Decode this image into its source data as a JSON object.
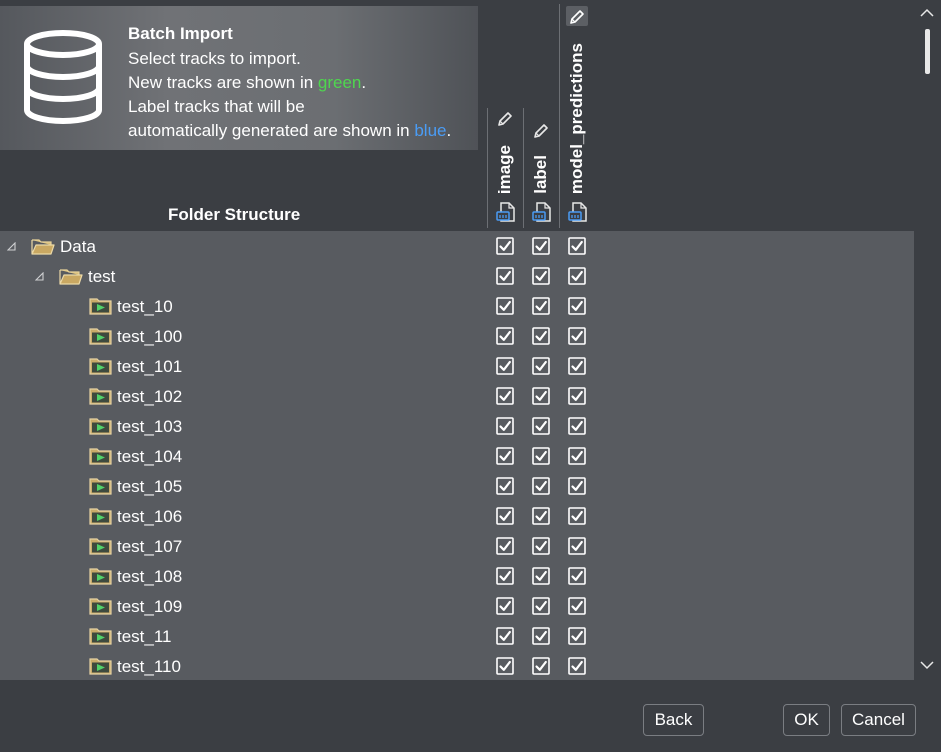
{
  "banner": {
    "title": "Batch Import",
    "line1": "Select tracks to import.",
    "line2_pre": "New tracks are shown in ",
    "line2_green": "green",
    "line2_post": ".",
    "line3": "Label tracks that will be",
    "line4_pre": "automatically generated are shown in ",
    "line4_blue": "blue",
    "line4_post": ".",
    "icon": "database-icon"
  },
  "tree_header": "Folder Structure",
  "columns": [
    {
      "title": "image",
      "icon_top": "pencil-icon",
      "icon_bottom": "document-icon"
    },
    {
      "title": "label",
      "icon_top": "pencil-icon",
      "icon_bottom": "document-icon"
    },
    {
      "title": "model_predictions",
      "icon_top": "pencil-icon",
      "icon_bottom": "document-icon"
    }
  ],
  "tree": [
    {
      "label": "Data",
      "kind": "folder-open",
      "expanded": true,
      "checks": [
        true,
        true,
        true
      ]
    },
    {
      "label": "test",
      "kind": "folder-open",
      "expanded": true,
      "checks": [
        true,
        true,
        true
      ]
    },
    {
      "label": "test_10",
      "kind": "video-folder",
      "checks": [
        true,
        true,
        true
      ]
    },
    {
      "label": "test_100",
      "kind": "video-folder",
      "checks": [
        true,
        true,
        true
      ]
    },
    {
      "label": "test_101",
      "kind": "video-folder",
      "checks": [
        true,
        true,
        true
      ]
    },
    {
      "label": "test_102",
      "kind": "video-folder",
      "checks": [
        true,
        true,
        true
      ]
    },
    {
      "label": "test_103",
      "kind": "video-folder",
      "checks": [
        true,
        true,
        true
      ]
    },
    {
      "label": "test_104",
      "kind": "video-folder",
      "checks": [
        true,
        true,
        true
      ]
    },
    {
      "label": "test_105",
      "kind": "video-folder",
      "checks": [
        true,
        true,
        true
      ]
    },
    {
      "label": "test_106",
      "kind": "video-folder",
      "checks": [
        true,
        true,
        true
      ]
    },
    {
      "label": "test_107",
      "kind": "video-folder",
      "checks": [
        true,
        true,
        true
      ]
    },
    {
      "label": "test_108",
      "kind": "video-folder",
      "checks": [
        true,
        true,
        true
      ]
    },
    {
      "label": "test_109",
      "kind": "video-folder",
      "checks": [
        true,
        true,
        true
      ]
    },
    {
      "label": "test_11",
      "kind": "video-folder",
      "checks": [
        true,
        true,
        true
      ]
    },
    {
      "label": "test_110",
      "kind": "video-folder",
      "checks": [
        true,
        true,
        true
      ]
    }
  ],
  "buttons": {
    "back": "Back",
    "ok": "OK",
    "cancel": "Cancel"
  },
  "colors": {
    "new_track": "#4fd64f",
    "auto_generated": "#4a9cf5",
    "tree_bg": "#585b60",
    "window_bg": "#3b3e43"
  }
}
